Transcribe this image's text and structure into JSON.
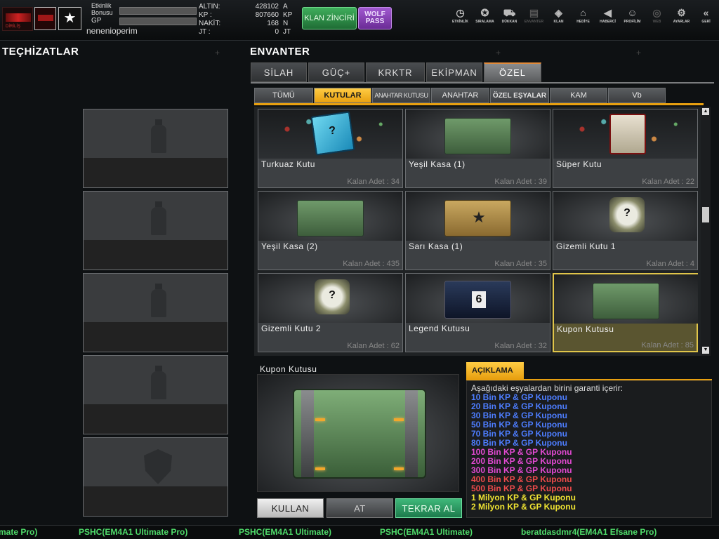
{
  "header": {
    "clan_logo_text": "DİRİLİŞ",
    "event_bonus_label": "Etkinlik Bonusu",
    "gp_label": "GP",
    "username": "nenenioperim",
    "stats": [
      {
        "key": "ALTIN:",
        "value": "428102",
        "unit": "A"
      },
      {
        "key": "KP :",
        "value": "807660",
        "unit": "KP"
      },
      {
        "key": "NAKİT:",
        "value": "168",
        "unit": "N"
      },
      {
        "key": "JT :",
        "value": "0",
        "unit": "JT"
      }
    ],
    "klan_button": "KLAN ZİNCİRİ",
    "wolf_button": "WOLF PASS",
    "nav": [
      {
        "label": "ETKİNLİK",
        "icon": "stopwatch-icon",
        "glyph": "◷"
      },
      {
        "label": "SIRALAMA",
        "icon": "medal-icon",
        "glyph": "✪"
      },
      {
        "label": "DÜKKAN",
        "icon": "cart-icon",
        "glyph": "⛟"
      },
      {
        "label": "ENVANTER",
        "icon": "inventory-icon",
        "glyph": "▤"
      },
      {
        "label": "KLAN",
        "icon": "clan-shield-icon",
        "glyph": "◈"
      },
      {
        "label": "HEDİYE",
        "icon": "gift-icon",
        "glyph": "⌂"
      },
      {
        "label": "HABERCİ",
        "icon": "megaphone-icon",
        "glyph": "◀"
      },
      {
        "label": "PROFİLİM",
        "icon": "profile-icon",
        "glyph": "☺"
      },
      {
        "label": "WEB",
        "icon": "globe-icon",
        "glyph": "◎"
      },
      {
        "label": "AYARLAR",
        "icon": "gear-icon",
        "glyph": "⚙"
      },
      {
        "label": "GERİ",
        "icon": "back-icon",
        "glyph": "«"
      }
    ]
  },
  "left": {
    "title": "TEÇHİZATLAR"
  },
  "inventory": {
    "title": "ENVANTER",
    "tabs": [
      "SİLAH",
      "GÜÇ+",
      "KRKTR",
      "EKİPMAN",
      "ÖZEL"
    ],
    "subtabs": [
      "TÜMÜ",
      "KUTULAR",
      "ANAHTAR KUTUSU",
      "ANAHTAR",
      "ÖZEL EŞYALAR",
      "KAM",
      "Vb"
    ],
    "items": [
      {
        "name": "Turkuaz Kutu",
        "count": "Kalan Adet : 34",
        "style": "blue"
      },
      {
        "name": "Yeşil Kasa (1)",
        "count": "Kalan Adet : 39",
        "style": "green"
      },
      {
        "name": "Süper Kutu",
        "count": "Kalan Adet : 22",
        "style": "gift"
      },
      {
        "name": "Yeşil Kasa (2)",
        "count": "Kalan Adet : 435",
        "style": "green"
      },
      {
        "name": "Sarı Kasa (1)",
        "count": "Kalan Adet : 35",
        "style": "gold"
      },
      {
        "name": "Gizemli Kutu 1",
        "count": "Kalan Adet : 4",
        "style": "mystery"
      },
      {
        "name": "Gizemli Kutu 2",
        "count": "Kalan Adet : 62",
        "style": "mystery"
      },
      {
        "name": "Legend Kutusu",
        "count": "Kalan Adet : 32",
        "style": "legend"
      },
      {
        "name": "Kupon Kutusu",
        "count": "Kalan Adet : 85",
        "style": "green"
      }
    ]
  },
  "preview": {
    "name": "Kupon Kutusu",
    "buttons": {
      "use": "KULLAN",
      "drop": "AT",
      "repeat": "TEKRAR AL"
    }
  },
  "description": {
    "tab": "AÇIKLAMA",
    "intro": "Aşağıdaki eşyalardan birini garanti içerir:",
    "lines": [
      {
        "text": "10 Bin KP & GP Kuponu",
        "color": "#4d7dff"
      },
      {
        "text": "20 Bin KP & GP Kuponu",
        "color": "#4d7dff"
      },
      {
        "text": "30 Bin KP & GP Kuponu",
        "color": "#4d7dff"
      },
      {
        "text": "50 Bin KP & GP Kuponu",
        "color": "#4d7dff"
      },
      {
        "text": "70 Bin KP & GP Kuponu",
        "color": "#4d7dff"
      },
      {
        "text": "80 Bin KP & GP Kuponu",
        "color": "#4d7dff"
      },
      {
        "text": "100 Bin KP & GP Kuponu",
        "color": "#e24ad2"
      },
      {
        "text": "200 Bin KP & GP Kuponu",
        "color": "#e24ad2"
      },
      {
        "text": "300 Bin KP & GP Kuponu",
        "color": "#e24ad2"
      },
      {
        "text": "400 Bin KP & GP Kuponu",
        "color": "#ee4b4b"
      },
      {
        "text": "500 Bin KP & GP Kuponu",
        "color": "#ee4b4b"
      },
      {
        "text": "1 Milyon KP & GP Kuponu",
        "color": "#f0e432"
      },
      {
        "text": "2 Milyon KP & GP Kuponu",
        "color": "#f0e432"
      }
    ]
  },
  "ticker": [
    "mate Pro)",
    "PSHC(EM4A1 Ultimate Pro)",
    "PSHC(EM4A1 Ultimate)",
    "PSHC(EM4A1 Ultimate)",
    "beratdasdmr4(EM4A1 Efsane Pro)"
  ]
}
